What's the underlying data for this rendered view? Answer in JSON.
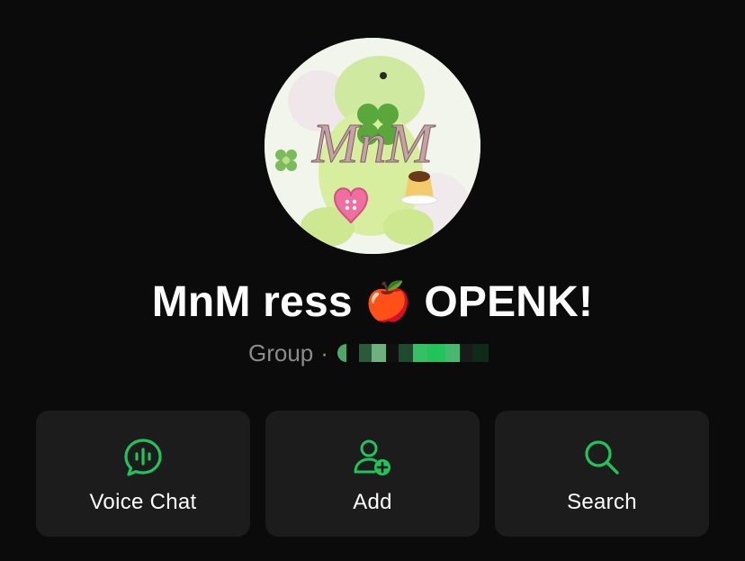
{
  "group": {
    "name": "MnM ress",
    "emoji": "🍎",
    "name_suffix": "OPENK!",
    "kind": "Group",
    "separator": "·"
  },
  "avatar": {
    "logo_text": "MnM"
  },
  "actions": [
    {
      "label": "Voice Chat",
      "icon": "voice-chat-icon"
    },
    {
      "label": "Add",
      "icon": "add-person-icon"
    },
    {
      "label": "Search",
      "icon": "search-icon"
    }
  ],
  "colors": {
    "background": "#0b0b0b",
    "card": "#1c1c1c",
    "accent": "#21c35b",
    "muted_text": "#8b8b8b",
    "text": "#ffffff"
  }
}
